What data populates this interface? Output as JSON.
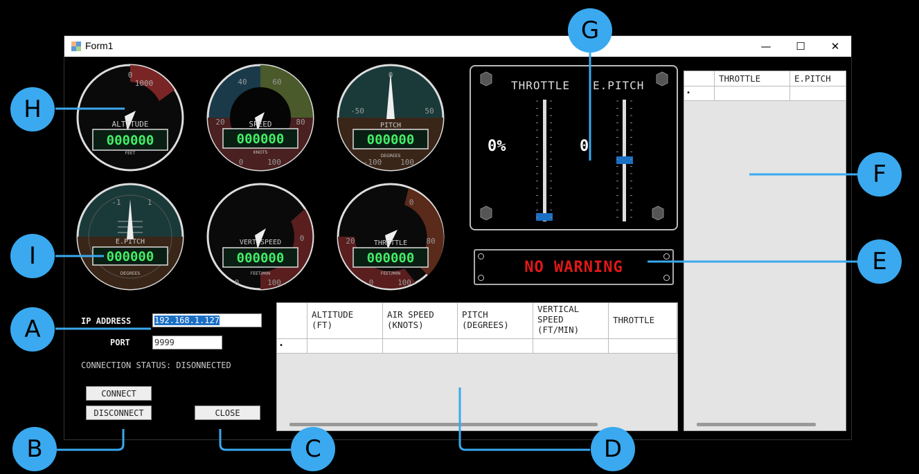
{
  "window": {
    "title": "Form1",
    "minimize": "—",
    "maximize": "☐",
    "close": "✕"
  },
  "gauges": [
    {
      "name": "ALTITUDE",
      "unit": "FEET",
      "display": "000000",
      "ticks": [
        "0",
        "1000"
      ]
    },
    {
      "name": "SPEED",
      "unit": "KNOTS",
      "display": "000000",
      "ticks": [
        "40",
        "60",
        "20",
        "80",
        "0",
        "100"
      ]
    },
    {
      "name": "PITCH",
      "unit": "DEGREES",
      "display": "000000",
      "ticks": [
        "0",
        "-50",
        "50",
        "-100",
        "100"
      ]
    },
    {
      "name": "E.PITCH",
      "unit": "DEGREES",
      "display": "000000",
      "ticks": [
        "-1",
        "1"
      ]
    },
    {
      "name": "VERT.SPEED",
      "unit": "FEET/MIN",
      "display": "000000",
      "ticks": [
        "0",
        "0",
        "100"
      ]
    },
    {
      "name": "THROTTLE",
      "unit": "FEET/MIN",
      "display": "000000",
      "ticks": [
        "0",
        "20",
        "80",
        "0",
        "100"
      ]
    }
  ],
  "throttle_panel": {
    "throttle_label": "THROTTLE",
    "epitch_label": "E.PITCH",
    "throttle_value": "0%",
    "epitch_value": "0",
    "throttle_level": 0.0,
    "epitch_level": 0.5
  },
  "warning": {
    "text": "NO WARNING"
  },
  "right_grid": {
    "headers": [
      "THROTTLE",
      "E.PITCH"
    ],
    "new_row_marker": "•"
  },
  "data_grid": {
    "headers": [
      "ALTITUDE\n(FT)",
      "AIR SPEED\n(KNOTS)",
      "PITCH\n(DEGREES)",
      "VERTICAL\nSPEED\n(FT/MIN)",
      "THROTTLE"
    ],
    "new_row_marker": "•"
  },
  "connection": {
    "ip_label": "IP ADDRESS",
    "ip_value": "192.168.1.127",
    "port_label": "PORT",
    "port_value": "9999",
    "status": "CONNECTION STATUS: DISONNECTED",
    "connect": "CONNECT",
    "disconnect": "DISCONNECT",
    "close": "CLOSE"
  },
  "callouts": [
    "A",
    "B",
    "C",
    "D",
    "E",
    "F",
    "G",
    "H",
    "I"
  ],
  "colors": {
    "accent": "#3aa9ef",
    "warning": "#e01818",
    "lcd_text": "#44ee66",
    "lcd_bg": "#0a1f14"
  }
}
